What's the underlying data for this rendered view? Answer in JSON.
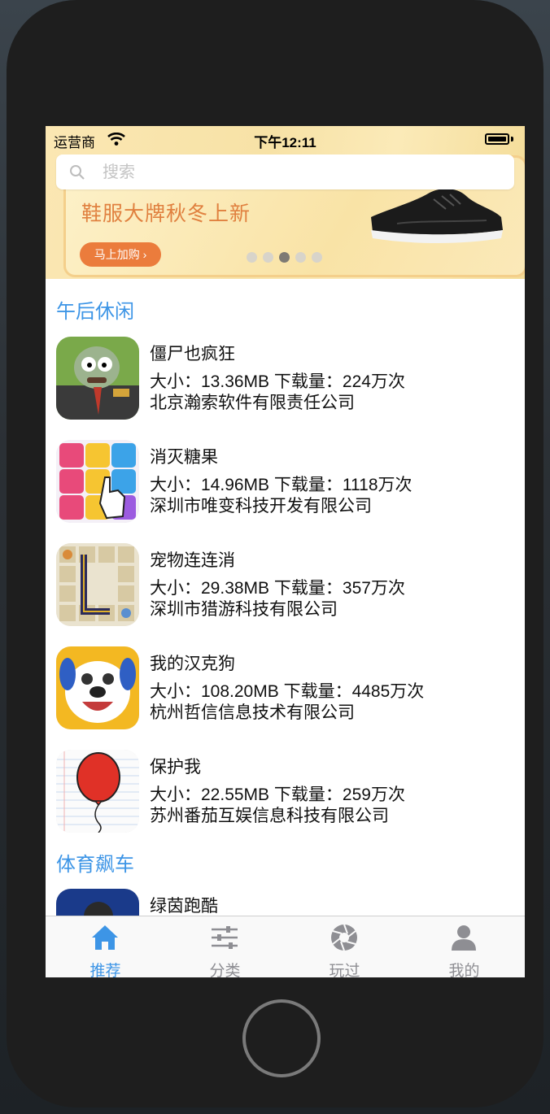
{
  "status_bar": {
    "carrier": "运营商",
    "time": "下午12:11"
  },
  "banner": {
    "headline": "鞋服大牌秋冬上新",
    "cta": "马上加购 ›",
    "active_dot": 3,
    "dot_count": 5
  },
  "search": {
    "placeholder": "搜索",
    "value": ""
  },
  "sections": [
    {
      "title": "午后休闲",
      "apps": [
        {
          "name": "僵尸也疯狂",
          "size": "大小：13.36MB",
          "downloads": "下载量：224万次",
          "developer": "北京瀚索软件有限责任公司",
          "icon": "zombie-game-icon"
        },
        {
          "name": "消灭糖果",
          "size": "大小：14.96MB",
          "downloads": "下载量：1118万次",
          "developer": "深圳市唯变科技开发有限公司",
          "icon": "candy-game-icon"
        },
        {
          "name": "宠物连连消",
          "size": "大小：29.38MB",
          "downloads": "下载量：357万次",
          "developer": "深圳市猎游科技有限公司",
          "icon": "pet-match-game-icon"
        },
        {
          "name": "我的汉克狗",
          "size": "大小：108.20MB",
          "downloads": "下载量：4485万次",
          "developer": "杭州哲信信息技术有限公司",
          "icon": "hank-dog-game-icon"
        },
        {
          "name": "保护我",
          "size": "大小：22.55MB",
          "downloads": "下载量：259万次",
          "developer": "苏州番茄互娱信息科技有限公司",
          "icon": "balloon-game-icon"
        }
      ]
    },
    {
      "title": "体育飙车",
      "apps": [
        {
          "name": "绿茵跑酷",
          "icon": "parkour-game-icon"
        }
      ]
    }
  ],
  "tabs": [
    {
      "label": "推荐",
      "icon": "home-icon",
      "active": true
    },
    {
      "label": "分类",
      "icon": "sliders-icon",
      "active": false
    },
    {
      "label": "玩过",
      "icon": "aperture-icon",
      "active": false
    },
    {
      "label": "我的",
      "icon": "user-icon",
      "active": false
    }
  ],
  "colors": {
    "accent": "#3d95e6",
    "banner_orange": "#eb7c3c",
    "tab_inactive": "#8e8e93"
  }
}
